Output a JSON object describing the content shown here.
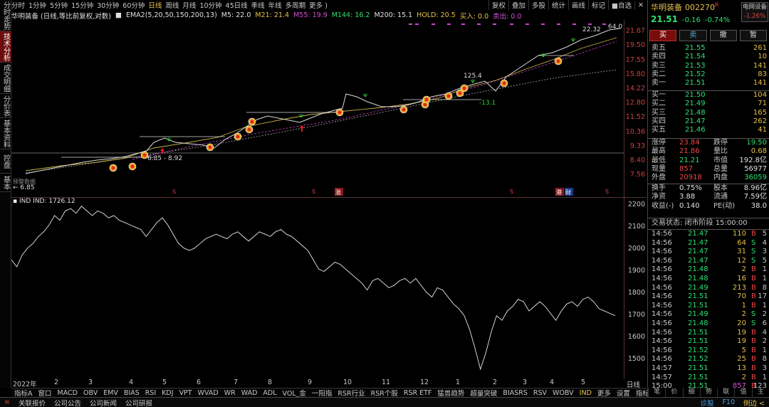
{
  "stock": {
    "name": "华明装备",
    "code": "002270",
    "r_flag": "R"
  },
  "side_tabs": [
    {
      "label": "分时走势",
      "active": false
    },
    {
      "label": "技术分析",
      "active": true
    },
    {
      "label": "成交明细",
      "active": false
    },
    {
      "label": "分价表",
      "active": false
    },
    {
      "label": "基本资料",
      "active": false
    },
    {
      "label": "控盘",
      "active": false
    },
    {
      "label": "基本",
      "active": false
    }
  ],
  "periods": [
    "分时",
    "1分钟",
    "5分钟",
    "15分钟",
    "30分钟",
    "60分钟",
    "日线",
    "周线",
    "月线",
    "10分钟",
    "45日线",
    "季线",
    "年线",
    "多周期",
    "更多 )"
  ],
  "active_period": "日线",
  "toolbar_right": [
    "复权",
    "叠加",
    "多股",
    "统计",
    "画线",
    "标记",
    "■自选"
  ],
  "close_btn": "✕",
  "indicator_row": {
    "title": "华明装备 (日线,等比前复权,对数)",
    "ema": "EMA2(5,20,50,150,200,13)",
    "m5": "M5: 22.0",
    "m21": "M21: 21.4",
    "m55": "M55: 19.9",
    "m144": "M144: 16.2",
    "m200": "M200: 15.1",
    "hold": "HOLD: 20.5",
    "buy": "买入: 0.0",
    "sell": "卖出: 0.0"
  },
  "price_axis": [
    "21.67",
    "19.50",
    "17.55",
    "15.80",
    "14.22",
    "12.80",
    "11.52",
    "10.36",
    "9.33",
    "8.40",
    "7.56"
  ],
  "chart_labels": {
    "high": "22.32",
    "high2": "64.0",
    "mid_a": "125.4",
    "mid_b": "-13.1",
    "range": "6.85 - 8.92",
    "low": "← 6.85",
    "low_tag": "预警数据"
  },
  "event_markers": [
    "S",
    "S",
    "涨",
    "S",
    "港",
    "财",
    "S"
  ],
  "ind_label": "IND  IND: 1726.12",
  "ind_axis": [
    "2200",
    "2100",
    "2000",
    "1900",
    "1800",
    "1700",
    "1600",
    "1500"
  ],
  "x_axis": [
    "2022年",
    "2",
    "3",
    "4",
    "5",
    "6",
    "7",
    "8",
    "9",
    "10",
    "11",
    "12",
    "1",
    "2",
    "3",
    "4",
    "5"
  ],
  "x_axis_end": "日线",
  "chart_data": {
    "type": "line",
    "title": "",
    "ylim": [
      1450,
      2220
    ],
    "ind_values": [
      1960,
      1930,
      1980,
      2010,
      2030,
      2060,
      2080,
      2110,
      2150,
      2130,
      2170,
      2180,
      2160,
      2190,
      2170,
      2150,
      2170,
      2160,
      2140,
      2150,
      2130,
      2120,
      2110,
      2100,
      2090,
      2060,
      2090,
      2120,
      2140,
      2110,
      2070,
      2030,
      2010,
      2000,
      2010,
      2030,
      2050,
      2060,
      2070,
      2060,
      2050,
      2070,
      2080,
      2060,
      2040,
      2060,
      2080,
      2070,
      2060,
      2080,
      2090,
      2070,
      2060,
      2040,
      2020,
      2000,
      1960,
      1920,
      1910,
      1930,
      1950,
      1940,
      1920,
      1900,
      1880,
      1860,
      1830,
      1870,
      1880,
      1860,
      1840,
      1850,
      1870,
      1880,
      1860,
      1880,
      1850,
      1820,
      1800,
      1840,
      1830,
      1800,
      1770,
      1750,
      1720,
      1660,
      1580,
      1490,
      1560,
      1650,
      1720,
      1700,
      1740,
      1760,
      1790,
      1780,
      1740,
      1760,
      1780,
      1760,
      1730,
      1700,
      1740,
      1770,
      1780,
      1760,
      1790,
      1800,
      1780,
      1750,
      1740,
      1730,
      1720
    ]
  },
  "quote": {
    "price": "21.51",
    "change": "-0.16",
    "pct": "-0.74%"
  },
  "badge": {
    "line1": "电网设备",
    "line2": "-1.26%"
  },
  "trade_buttons": [
    "买",
    "卖",
    "撤",
    "暂"
  ],
  "asks": [
    {
      "label": "卖五",
      "price": "21.55",
      "vol": "261"
    },
    {
      "label": "卖四",
      "price": "21.54",
      "vol": "10"
    },
    {
      "label": "卖三",
      "price": "21.53",
      "vol": "141"
    },
    {
      "label": "卖二",
      "price": "21.52",
      "vol": "83"
    },
    {
      "label": "卖一",
      "price": "21.51",
      "vol": "141"
    }
  ],
  "bids": [
    {
      "label": "买一",
      "price": "21.50",
      "vol": "104"
    },
    {
      "label": "买二",
      "price": "21.49",
      "vol": "71"
    },
    {
      "label": "买三",
      "price": "21.48",
      "vol": "165"
    },
    {
      "label": "买四",
      "price": "21.47",
      "vol": "262"
    },
    {
      "label": "买五",
      "price": "21.46",
      "vol": "41"
    }
  ],
  "stats": [
    {
      "k1": "涨停",
      "v1": "23.84",
      "k2": "跌停",
      "v2": "19.50"
    },
    {
      "k1": "最高",
      "v1": "21.86",
      "k2": "量比",
      "v2": "0.68"
    },
    {
      "k1": "最低",
      "v1": "21.21",
      "k2": "市值",
      "v2": "192.8亿"
    },
    {
      "k1": "现量",
      "v1": "857",
      "k2": "总量",
      "v2": "56977"
    },
    {
      "k1": "外盘",
      "v1": "20918",
      "k2": "内盘",
      "v2": "36059"
    },
    {
      "k1": "换手",
      "v1": "0.75%",
      "k2": "股本",
      "v2": "8.96亿"
    },
    {
      "k1": "净资",
      "v1": "3.88",
      "k2": "流通",
      "v2": "7.59亿"
    },
    {
      "k1": "收益(-)",
      "v1": "0.140",
      "k2": "PE(动)",
      "v2": "38.0"
    }
  ],
  "trade_status": "交易状态: 闭市阶段 15:00:00",
  "ticks": [
    {
      "t": "14:56",
      "p": "21.47",
      "v": "110",
      "s": "B",
      "n": "5"
    },
    {
      "t": "14:56",
      "p": "21.47",
      "v": "64",
      "s": "S",
      "n": "4"
    },
    {
      "t": "14:56",
      "p": "21.47",
      "v": "31",
      "s": "S",
      "n": "3"
    },
    {
      "t": "14:56",
      "p": "21.47",
      "v": "12",
      "s": "S",
      "n": "5"
    },
    {
      "t": "14:56",
      "p": "21.48",
      "v": "2",
      "s": "B",
      "n": "1"
    },
    {
      "t": "14:56",
      "p": "21.48",
      "v": "16",
      "s": "B",
      "n": "1"
    },
    {
      "t": "14:56",
      "p": "21.49",
      "v": "213",
      "s": "B",
      "n": "8"
    },
    {
      "t": "14:56",
      "p": "21.51",
      "v": "70",
      "s": "B",
      "n": "17"
    },
    {
      "t": "14:56",
      "p": "21.51",
      "v": "1",
      "s": "B",
      "n": "1"
    },
    {
      "t": "14:56",
      "p": "21.49",
      "v": "2",
      "s": "S",
      "n": "2"
    },
    {
      "t": "14:56",
      "p": "21.48",
      "v": "20",
      "s": "S",
      "n": "6"
    },
    {
      "t": "14:56",
      "p": "21.51",
      "v": "19",
      "s": "B",
      "n": "4"
    },
    {
      "t": "14:56",
      "p": "21.51",
      "v": "19",
      "s": "B",
      "n": "2"
    },
    {
      "t": "14:56",
      "p": "21.52",
      "v": "5",
      "s": "B",
      "n": "1"
    },
    {
      "t": "14:56",
      "p": "21.52",
      "v": "25",
      "s": "B",
      "n": "8"
    },
    {
      "t": "14:57",
      "p": "21.51",
      "v": "13",
      "s": "B",
      "n": "3"
    },
    {
      "t": "14:57",
      "p": "21.51",
      "v": "2",
      "s": "B",
      "n": "1"
    },
    {
      "t": "15:00",
      "p": "21.51",
      "v": "857",
      "s": "B",
      "n": "123"
    }
  ],
  "bottom_indicators": [
    "指标A",
    "窗口",
    "MACD",
    "OBV",
    "EMV",
    "BIAS",
    "RSI",
    "KDJ",
    "VPT",
    "WVAD",
    "WR",
    "WAD",
    "ADL",
    "VOL_金",
    "一阳指",
    "RSR行业",
    "RSR个股",
    "RSR ETF",
    "猛兽趋势",
    "超量突破",
    "BIASRS",
    "RSV",
    "WOBV",
    "IND",
    "更多",
    "设置"
  ],
  "bottom_active": "IND",
  "bottom_right": [
    "指标B",
    "模",
    "板"
  ],
  "right_tabs": [
    "笔",
    "价",
    "细",
    "势",
    "联",
    "值",
    "主"
  ],
  "statusbar": [
    "关联报价",
    "公司公告",
    "公司新闻",
    "公司研报"
  ],
  "statusbar_right": [
    "诊股",
    "F10",
    "侧边 <"
  ]
}
